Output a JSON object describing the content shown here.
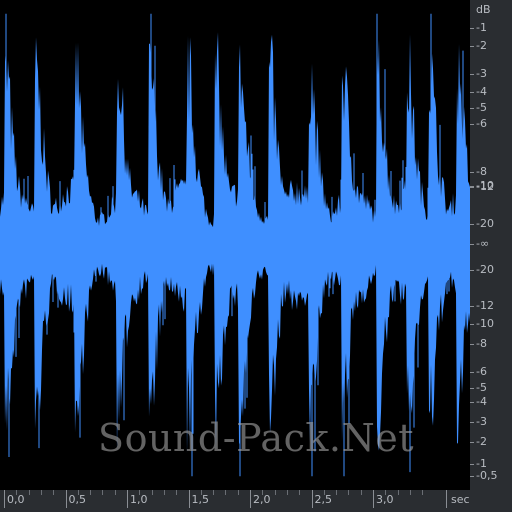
{
  "wave_color": "#3f8fff",
  "background_color": "#000000",
  "ruler_color": "#2a2d31",
  "db_scale": {
    "unit": "dB",
    "labels": [
      "-1",
      "-2",
      "-3",
      "-4",
      "-5",
      "-6",
      "-8",
      "-10",
      "-12",
      "-20",
      "-∞",
      "-20",
      "-12",
      "-10",
      "-8",
      "-6",
      "-5",
      "-4",
      "-3",
      "-2",
      "-1",
      "-0,5"
    ]
  },
  "time_scale": {
    "unit": "sec",
    "labels": [
      "0,0",
      "0,5",
      "1,0",
      "1,5",
      "2,0",
      "2,5",
      "3,0"
    ]
  },
  "watermark": "Sound-Pack.Net"
}
